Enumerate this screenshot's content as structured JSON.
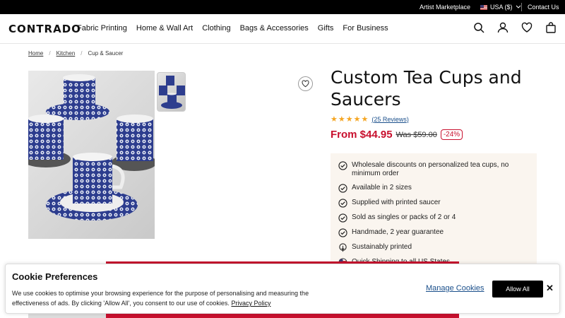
{
  "topbar": {
    "artist_link": "Artist Marketplace",
    "locale": "USA ($)",
    "contact_link": "Contact Us"
  },
  "nav": {
    "logo": "CONTRADO",
    "links": [
      "Fabric Printing",
      "Home & Wall Art",
      "Clothing",
      "Bags & Accessories",
      "Gifts",
      "For Business"
    ]
  },
  "breadcrumb": [
    "Home",
    "Kitchen",
    "Cup & Saucer"
  ],
  "product": {
    "title": "Custom Tea Cups and Saucers",
    "rating_stars": 5,
    "reviews": "(25 Reviews)",
    "price_from": "From $44.95",
    "price_was": "Was $59.00",
    "discount": "-24%",
    "features": [
      "Wholesale discounts on personalized tea cups, no minimum order",
      "Available in 2 sizes",
      "Supplied with printed saucer",
      "Sold as singles or packs of 2 or 4",
      "Handmade, 2 year guarantee",
      "Sustainably printed",
      "Quick Shipping to all US States"
    ]
  },
  "cookie": {
    "title": "Cookie Preferences",
    "text": "We use cookies to optimise your browsing experience for the purpose of personalising and measuring the effectiveness of ads. By clicking 'Allow All', you consent to our use of cookies.",
    "policy_link": "Privacy Policy",
    "manage_label": "Manage Cookies",
    "allow_label": "Allow All",
    "close_label": "✕"
  },
  "colors": {
    "accent_red": "#c8102e",
    "link_blue": "#1a4f8b",
    "feature_bg": "#faf5ef",
    "star": "#f5a623"
  }
}
